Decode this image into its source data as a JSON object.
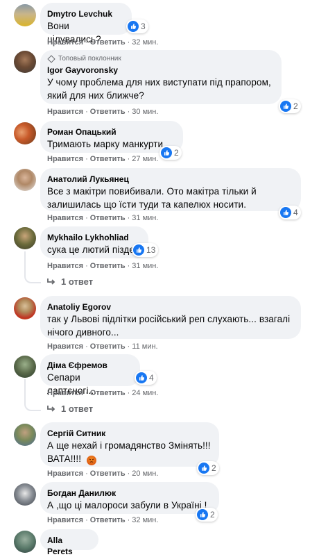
{
  "colors": {
    "like": "#1877f2",
    "bubble": "#f0f2f5",
    "meta": "#65676b",
    "angry": "#e9710f"
  },
  "comments": [
    {
      "name": "Dmytro Levchuk",
      "text": [
        "Вони цілувались?"
      ],
      "like_label": "Нравится",
      "reply_label": "Ответить",
      "time": "32 мин.",
      "reactions": "3"
    },
    {
      "badge": "Топовый поклонник",
      "name": "Igor Gayvoronsky",
      "text": [
        "У чому проблема для них виступати під прапором,",
        "який для них ближче?"
      ],
      "like_label": "Нравится",
      "reply_label": "Ответить",
      "time": "30 мин.",
      "reactions": "2"
    },
    {
      "name": "Роман Опацький",
      "text": [
        "Тримають марку манкурти...."
      ],
      "like_label": "Нравится",
      "reply_label": "Ответить",
      "time": "27 мин.",
      "reactions": "2"
    },
    {
      "name": "Анатолий Лукьянец",
      "text": [
        "Все з макітри повибивали. Ото макітра тільки й",
        "залишилась що їсти туди та капелюх носити."
      ],
      "like_label": "Нравится",
      "reply_label": "Ответить",
      "time": "31 мин.",
      "reactions": "4"
    },
    {
      "name": "Mykhailo Lykhohliad",
      "text": [
        "сука це лютий піздєц"
      ],
      "like_label": "Нравится",
      "reply_label": "Ответить",
      "time": "31 мин.",
      "reactions": "13",
      "replies": "1 ответ"
    },
    {
      "name": "Anatoliy Egorov",
      "text": [
        "так у Львові підлітки російський реп слухають... взагалі",
        "нічого дивного..."
      ],
      "like_label": "Нравится",
      "reply_label": "Ответить",
      "time": "11 мин."
    },
    {
      "name": "Діма Єфремов",
      "text": [
        "Сепари лаптєногі...."
      ],
      "like_label": "Нравится",
      "reply_label": "Ответить",
      "time": "24 мин.",
      "reactions": "4",
      "replies": "1 ответ"
    },
    {
      "name": "Сергій Ситник",
      "text": [
        "А ще нехай і громадянство Змінять!!!",
        "ВАТА!!!!"
      ],
      "like_label": "Нравится",
      "reply_label": "Ответить",
      "time": "20 мин.",
      "reactions": "2"
    },
    {
      "name": "Богдан Данилюк",
      "text": [
        "А ,що ці малороси забули в Україні !"
      ],
      "like_label": "Нравится",
      "reply_label": "Ответить",
      "time": "32 мин.",
      "reactions": "2"
    },
    {
      "name": "Alla Perets"
    }
  ]
}
